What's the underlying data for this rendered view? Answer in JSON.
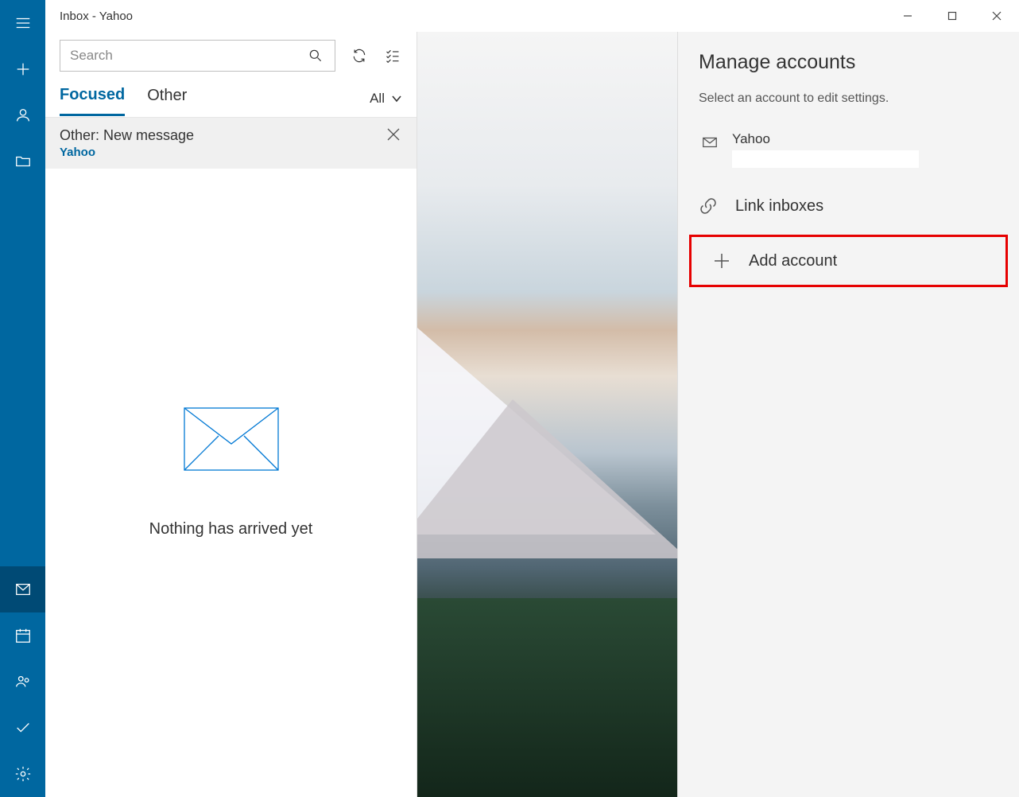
{
  "window": {
    "title": "Inbox - Yahoo"
  },
  "search": {
    "placeholder": "Search"
  },
  "tabs": {
    "focused": "Focused",
    "other": "Other",
    "filter": "All"
  },
  "banner": {
    "title": "Other: New message",
    "account": "Yahoo"
  },
  "empty": {
    "message": "Nothing has arrived yet"
  },
  "panel": {
    "heading": "Manage accounts",
    "subtitle": "Select an account to edit settings.",
    "account": {
      "name": "Yahoo",
      "email": ""
    },
    "link_inboxes": "Link inboxes",
    "add_account": "Add account"
  }
}
